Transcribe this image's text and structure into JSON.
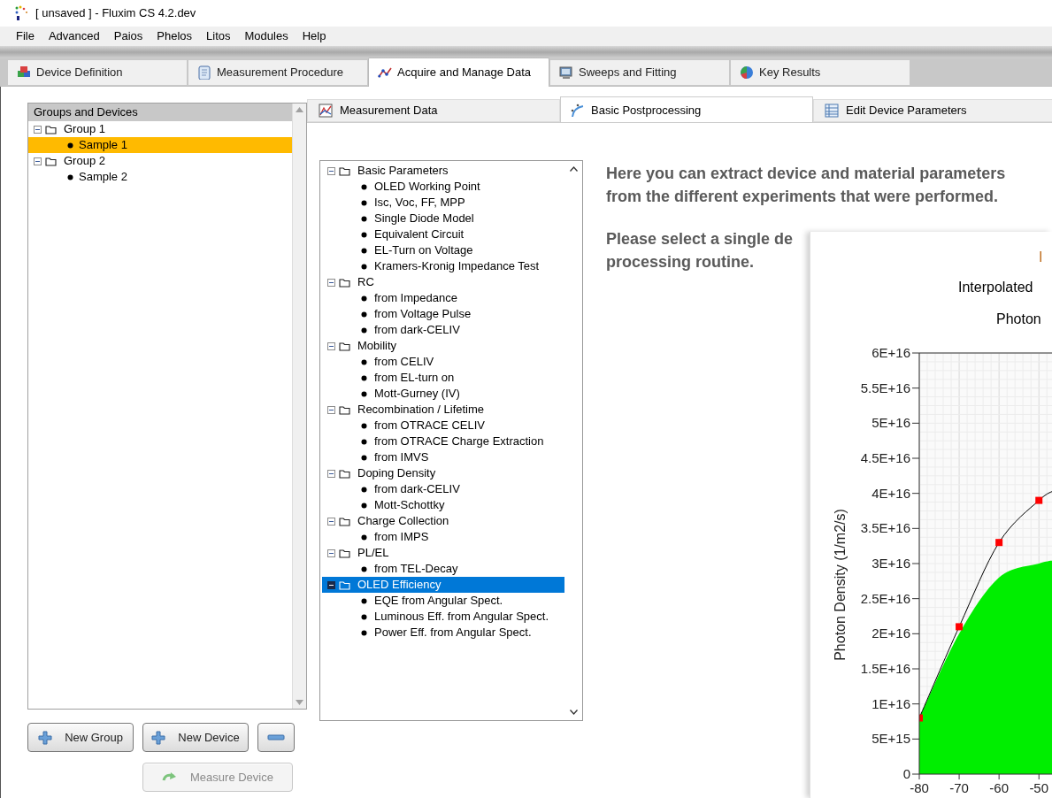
{
  "window": {
    "title": "[ unsaved ] - Fluxim CS 4.2.dev"
  },
  "menu": [
    "File",
    "Advanced",
    "Paios",
    "Phelos",
    "Litos",
    "Modules",
    "Help"
  ],
  "tabs": [
    {
      "label": "Device Definition",
      "selected": false
    },
    {
      "label": "Measurement Procedure",
      "selected": false
    },
    {
      "label": "Acquire and Manage Data",
      "selected": true
    },
    {
      "label": "Sweeps and Fitting",
      "selected": false
    },
    {
      "label": "Key Results",
      "selected": false
    }
  ],
  "device_list": {
    "header": "Groups and Devices",
    "items": [
      {
        "label": "Group 1",
        "expanded": true,
        "selected": false,
        "children": [
          {
            "label": "Sample 1",
            "selected": true
          }
        ]
      },
      {
        "label": "Group 2",
        "expanded": true,
        "selected": false,
        "children": [
          {
            "label": "Sample 2",
            "selected": false
          }
        ]
      }
    ]
  },
  "buttons": [
    {
      "label": "New Group",
      "kind": "add",
      "disabled": false
    },
    {
      "label": "New Device",
      "kind": "add",
      "disabled": false
    },
    {
      "kind": "remove",
      "disabled": false
    },
    {
      "label": "Measure Device",
      "kind": "measure",
      "disabled": true
    }
  ],
  "sub_tabs": [
    {
      "label": "Measurement Data",
      "selected": false
    },
    {
      "label": "Basic Postprocessing",
      "selected": true
    },
    {
      "label": "Edit Device Parameters",
      "selected": false
    }
  ],
  "routines": [
    {
      "label": "Basic Parameters",
      "expanded": true,
      "selected": false,
      "children": [
        {
          "label": "OLED Working Point"
        },
        {
          "label": "Isc, Voc, FF, MPP"
        },
        {
          "label": "Single Diode Model"
        },
        {
          "label": "Equivalent Circuit"
        },
        {
          "label": "EL-Turn on Voltage"
        },
        {
          "label": "Kramers-Kronig Impedance Test"
        }
      ]
    },
    {
      "label": "RC",
      "expanded": true,
      "selected": false,
      "children": [
        {
          "label": "from Impedance"
        },
        {
          "label": "from Voltage Pulse"
        },
        {
          "label": "from dark-CELIV"
        }
      ]
    },
    {
      "label": "Mobility",
      "expanded": true,
      "selected": false,
      "children": [
        {
          "label": "from CELIV"
        },
        {
          "label": "from EL-turn on"
        },
        {
          "label": "Mott-Gurney (IV)"
        }
      ]
    },
    {
      "label": "Recombination / Lifetime",
      "expanded": true,
      "selected": false,
      "children": [
        {
          "label": "from OTRACE CELIV"
        },
        {
          "label": "from OTRACE Charge Extraction"
        },
        {
          "label": "from IMVS"
        }
      ]
    },
    {
      "label": "Doping Density",
      "expanded": true,
      "selected": false,
      "children": [
        {
          "label": "from dark-CELIV"
        },
        {
          "label": "Mott-Schottky"
        }
      ]
    },
    {
      "label": "Charge Collection",
      "expanded": true,
      "selected": false,
      "children": [
        {
          "label": "from IMPS"
        }
      ]
    },
    {
      "label": "PL/EL",
      "expanded": true,
      "selected": false,
      "children": [
        {
          "label": "from TEL-Decay"
        }
      ]
    },
    {
      "label": "OLED Efficiency",
      "expanded": true,
      "selected": true,
      "children": [
        {
          "label": "EQE from Angular Spect."
        },
        {
          "label": "Luminous Eff. from Angular Spect."
        },
        {
          "label": "Power Eff. from Angular Spect."
        }
      ]
    }
  ],
  "intro": {
    "paragraphs": [
      [
        "Here you can extract device and material parameters",
        "from the different experiments that were performed."
      ],
      [
        "Please select a single de",
        "processing routine."
      ]
    ]
  },
  "plot_window": {
    "header": "I",
    "subtitle": "Interpolated",
    "caption": "Photon",
    "chart_data": {
      "type": "line",
      "ylabel": "Photon Density (1/m2/s)",
      "x": [
        -80,
        -70,
        -60,
        -50
      ],
      "grid": true,
      "series": [
        {
          "type": "line",
          "marker": "square",
          "color": "#000000",
          "values": [
            8000000000000000.0,
            2.1e+16,
            3.3e+16,
            3.9e+16
          ]
        },
        {
          "type": "area",
          "color": "#00ee00",
          "values": [
            8000000000000000.0,
            2e+16,
            2.8e+16,
            3e+16
          ]
        }
      ],
      "xlim": [
        -80,
        -46.5
      ],
      "ylim": [
        0,
        6e+16
      ],
      "xticks": [
        -80,
        -70,
        -60,
        -50
      ],
      "yticks": [
        {
          "value": 0,
          "label": "0"
        },
        {
          "value": 5000000000000000.0,
          "label": "5E+15"
        },
        {
          "value": 1e+16,
          "label": "1E+16"
        },
        {
          "value": 1.5e+16,
          "label": "1.5E+16"
        },
        {
          "value": 2e+16,
          "label": "2E+16"
        },
        {
          "value": 2.5e+16,
          "label": "2.5E+16"
        },
        {
          "value": 3e+16,
          "label": "3E+16"
        },
        {
          "value": 3.5e+16,
          "label": "3.5E+16"
        },
        {
          "value": 4e+16,
          "label": "4E+16"
        },
        {
          "value": 4.5e+16,
          "label": "4.5E+16"
        },
        {
          "value": 5e+16,
          "label": "5E+16"
        },
        {
          "value": 5.5e+16,
          "label": "5.5E+16"
        },
        {
          "value": 6e+16,
          "label": "6E+16"
        }
      ]
    }
  }
}
